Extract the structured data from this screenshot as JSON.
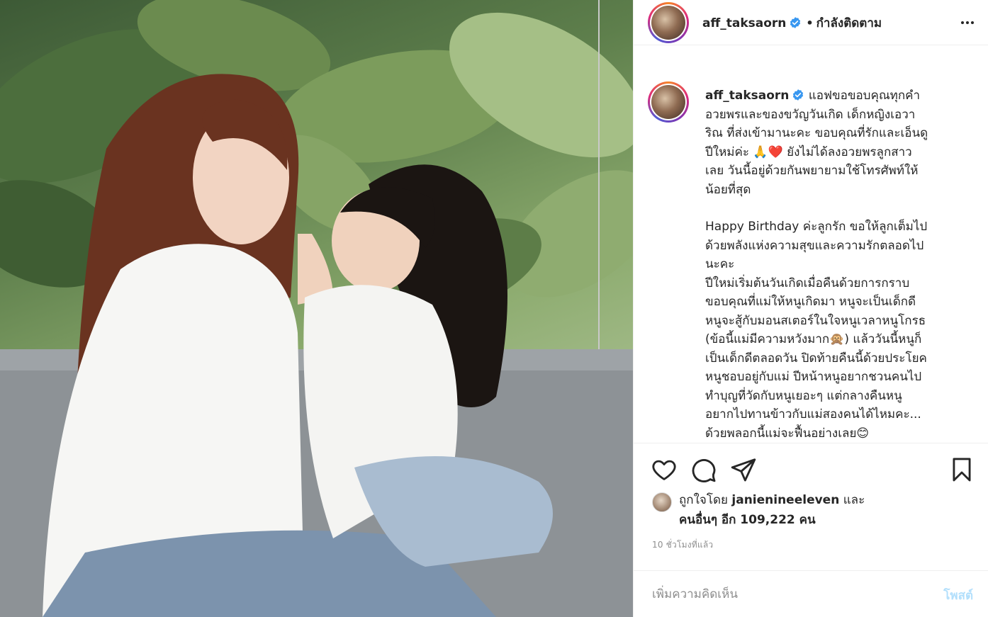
{
  "post": {
    "image_alt": "mother and daughter photo",
    "username": "aff_taksaorn",
    "follow_status": "กำลังติดตาม",
    "caption_lines_1": [
      "แอฟขอขอบคุณทุกคำ",
      "อวยพรและของขวัญวันเกิด เด็กหญิงเอวา",
      "ริณ ที่ส่งเข้ามานะคะ ขอบคุณที่รักและเอ็นดู",
      "ปีใหม่ค่ะ 🙏❤️ ยังไม่ได้ลงอวยพรลูกสาว",
      "เลย วันนี้อยู่ด้วยกันพยายามใช้โทรศัพท์ให้",
      "น้อยที่สุด"
    ],
    "caption_lines_2": [
      "Happy Birthday ค่ะลูกรัก ขอให้ลูกเต็มไป",
      "ด้วยพลังแห่งความสุขและความรักตลอดไป",
      "นะคะ",
      "ปีใหม่เริ่มต้นวันเกิดเมื่อคืนด้วยการกราบ",
      "ขอบคุณที่แม่ให้หนูเกิดมา หนูจะเป็นเด็กดี",
      "หนูจะสู้กับมอนสเตอร์ในใจหนูเวลาหนูโกรธ",
      "(ข้อนี้แม่มีความหวังมาก🙊) แล้ววันนี้หนูก็",
      "เป็นเด็กดีตลอดวัน ปิดท้ายคืนนี้ด้วยประโยค",
      "หนูชอบอยู่กับแม่ ปีหน้าหนูอยากชวนคนไป",
      "ทำบุญที่วัดกับหนูเยอะๆ แต่กลางคืนหนู",
      "อยากไปทานข้าวกับแม่สองคนได้ไหมคะ...",
      "ด้วยพลอกนี้แม่จะฟื้นอย่างเลย😊"
    ],
    "likes_prefix": "ถูกใจโดย",
    "liked_by_user": "janienineeleven",
    "likes_and": "และ",
    "likes_others": "คนอื่นๆ อีก 109,222 คน",
    "time_ago": "10 ชั่วโมงที่แล้ว",
    "comment_placeholder": "เพิ่มความคิดเห็น",
    "post_button": "โพสต์"
  },
  "colors": {
    "verified": "#3897f0",
    "post_disabled": "#b2dffc",
    "muted": "#8e8e8e"
  },
  "icons": [
    "more-icon",
    "verified-icon",
    "heart-icon",
    "comment-icon",
    "share-icon",
    "bookmark-icon"
  ]
}
